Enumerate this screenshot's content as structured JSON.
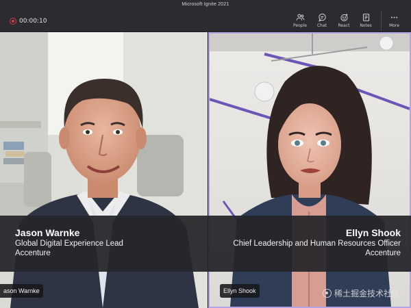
{
  "window": {
    "title": "Microsoft Ignite 2021"
  },
  "recording": {
    "timer": "00:00:10"
  },
  "toolbar": {
    "items": [
      {
        "label": "People",
        "icon": "people-icon"
      },
      {
        "label": "Chat",
        "icon": "chat-icon"
      },
      {
        "label": "React",
        "icon": "react-icon"
      },
      {
        "label": "Notes",
        "icon": "notes-icon"
      },
      {
        "label": "More",
        "icon": "more-icon"
      }
    ]
  },
  "speakers": [
    {
      "name": "Jason Warnke",
      "title": "Global Digital Experience Lead",
      "company": "Accenture",
      "tag": "ason Warnke"
    },
    {
      "name": "Ellyn Shook",
      "title": "Chief Leadership and Human Resources Officer",
      "company": "Accenture",
      "tag": "Ellyn Shook"
    }
  ],
  "watermark": {
    "text": "稀土掘金技术社区"
  },
  "colors": {
    "topbar": "#2b2b30",
    "active_speaker_border": "#b4a4e6",
    "record": "#d8394b",
    "caption_band": "#26262a"
  }
}
